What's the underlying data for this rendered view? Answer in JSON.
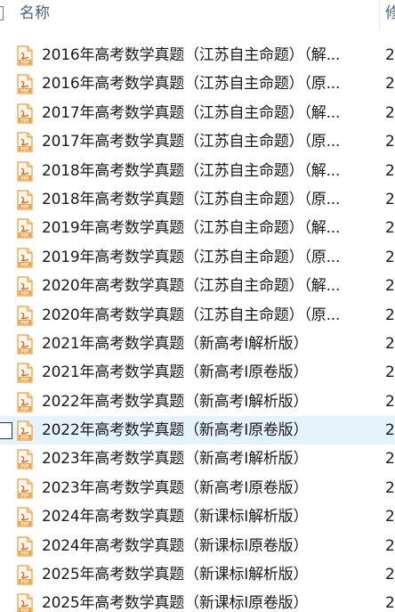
{
  "header": {
    "sort_indicator": "^",
    "name_column": "名称",
    "date_column": "修"
  },
  "colors": {
    "pdf_icon_fill": "#f2a03c",
    "hover_row": "#e5f3ff",
    "header_text": "#4c607a"
  },
  "icons": {
    "file": "pdf-file-icon"
  },
  "files": [
    {
      "name": "2016年高考数学真题（江苏自主命题）（解...",
      "date": "2",
      "hover": false
    },
    {
      "name": "2016年高考数学真题（江苏自主命题）（原...",
      "date": "2",
      "hover": false
    },
    {
      "name": "2017年高考数学真题（江苏自主命题）（解...",
      "date": "2",
      "hover": false
    },
    {
      "name": "2017年高考数学真题（江苏自主命题）（原...",
      "date": "2",
      "hover": false
    },
    {
      "name": "2018年高考数学真题（江苏自主命题）（解...",
      "date": "2",
      "hover": false
    },
    {
      "name": "2018年高考数学真题（江苏自主命题）（原...",
      "date": "2",
      "hover": false
    },
    {
      "name": "2019年高考数学真题（江苏自主命题）（解...",
      "date": "2",
      "hover": false
    },
    {
      "name": "2019年高考数学真题（江苏自主命题）（原...",
      "date": "2",
      "hover": false
    },
    {
      "name": "2020年高考数学真题（江苏自主命题）（解...",
      "date": "2",
      "hover": false
    },
    {
      "name": "2020年高考数学真题（江苏自主命题）（原...",
      "date": "2",
      "hover": false
    },
    {
      "name": "2021年高考数学真题（新高考Ⅰ解析版）",
      "date": "2",
      "hover": false
    },
    {
      "name": "2021年高考数学真题（新高考Ⅰ原卷版）",
      "date": "2",
      "hover": false
    },
    {
      "name": "2022年高考数学真题（新高考Ⅰ解析版）",
      "date": "2",
      "hover": false
    },
    {
      "name": "2022年高考数学真题（新高考Ⅰ原卷版）",
      "date": "2",
      "hover": true
    },
    {
      "name": "2023年高考数学真题（新高考Ⅰ解析版）",
      "date": "2",
      "hover": false
    },
    {
      "name": "2023年高考数学真题（新高考Ⅰ原卷版）",
      "date": "2",
      "hover": false
    },
    {
      "name": "2024年高考数学真题（新课标Ⅰ解析版）",
      "date": "2",
      "hover": false
    },
    {
      "name": "2024年高考数学真题（新课标Ⅰ原卷版）",
      "date": "2",
      "hover": false
    },
    {
      "name": "2025年高考数学真题（新课标Ⅰ解析版）",
      "date": "2",
      "hover": false
    },
    {
      "name": "2025年高考数学真题（新课标Ⅰ原卷版）",
      "date": "2",
      "hover": false
    }
  ]
}
